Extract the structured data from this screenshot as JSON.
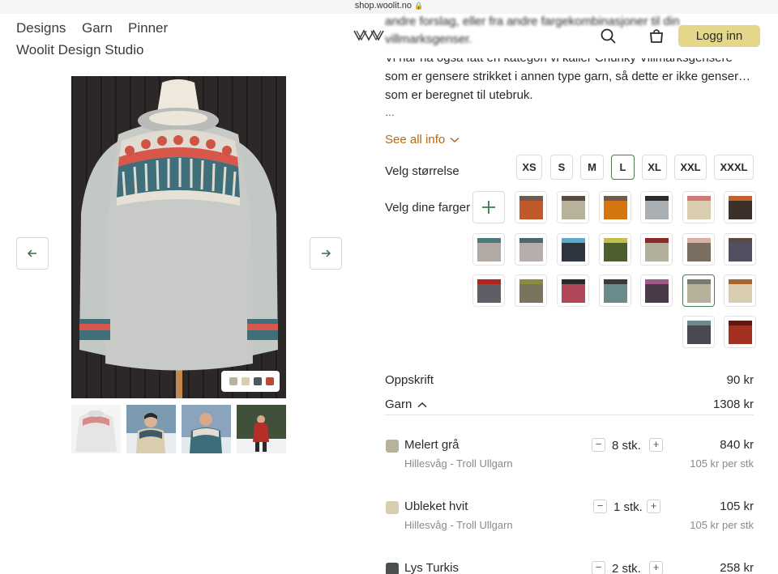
{
  "browser": {
    "url": "shop.woolit.no"
  },
  "nav": {
    "designs": "Designs",
    "garn": "Garn",
    "pinner": "Pinner",
    "studio": "Woolit Design Studio",
    "login": "Logg inn"
  },
  "description": {
    "blurred_line1": "andre forslag, eller fra andre fargekombinasjoner til din",
    "blurred_line2": "villmarksgenser.",
    "line1": "Vi har nå også fått en kategori vi kaller Chunky Villmarksgensere",
    "line2": "som er gensere strikket i annen type garn, så dette er ikke genser…",
    "line3": "som er beregnet til utebruk.",
    "ellipsis": "…",
    "see_all": "See all info"
  },
  "image_dots": [
    "#b8b3a0",
    "#d9cdb0",
    "#4a5a5a",
    "#b84a34"
  ],
  "size": {
    "label": "Velg størrelse",
    "options": [
      "XS",
      "S",
      "M",
      "L",
      "XL",
      "XXL",
      "XXXL"
    ],
    "selected": "L"
  },
  "colors": {
    "label": "Velg dine farger",
    "swatches": [
      [
        "#6e5a4e",
        "#c15a2a"
      ],
      [
        "#5a4a40",
        "#b6b29c"
      ],
      [
        "#6e5a4e",
        "#d57510"
      ],
      [
        "#2a2a2a",
        "#a9afb3"
      ],
      [
        "#d27878",
        "#d9cdb0"
      ],
      [
        "#c0602a",
        "#3c302a"
      ],
      [
        "#4a7a7a",
        "#b2aaa2"
      ],
      [
        "#4a6868",
        "#b6aeac"
      ],
      [
        "#5ba9cc",
        "#2d3540"
      ],
      [
        "#c2c04a",
        "#4e5e2e"
      ],
      [
        "#8a2a2a",
        "#b2b09c"
      ],
      [
        "#d9b0a8",
        "#7a6e60"
      ],
      [
        "#5a4a40",
        "#525060"
      ],
      [
        "#b0241a",
        "#5e5e66"
      ],
      [
        "#8a8a3e",
        "#7c7260"
      ],
      [
        "#2a2a2a",
        "#b0485a"
      ],
      [
        "#3a3a3a",
        "#6a8a8e"
      ],
      [
        "#a05a8a",
        "#4a3a4a"
      ],
      [
        "#7a7a6a",
        "#b4b09a"
      ],
      [
        "#a8642a",
        "#d9cdb0"
      ],
      [
        "#6a8a8e",
        "#4a4850"
      ],
      [
        "#5a1a12",
        "#a43020"
      ]
    ]
  },
  "pricing": {
    "pattern_label": "Oppskrift",
    "pattern_price": "90 kr",
    "yarn_label": "Garn",
    "yarn_price": "1308 kr"
  },
  "yarns": [
    {
      "name": "Melert grå",
      "brand": "Hillesvåg - Troll Ullgarn",
      "qty": "8 stk.",
      "price": "840 kr",
      "unit": "105 kr per stk",
      "color": "#b6b29c"
    },
    {
      "name": "Ubleket hvit",
      "brand": "Hillesvåg - Troll Ullgarn",
      "qty": "1 stk.",
      "price": "105 kr",
      "unit": "105 kr per stk",
      "color": "#d9cdb0"
    },
    {
      "name": "Lys Turkis",
      "brand": "",
      "qty": "2 stk.",
      "price": "258 kr",
      "unit": "",
      "color": "#4a5050"
    }
  ]
}
